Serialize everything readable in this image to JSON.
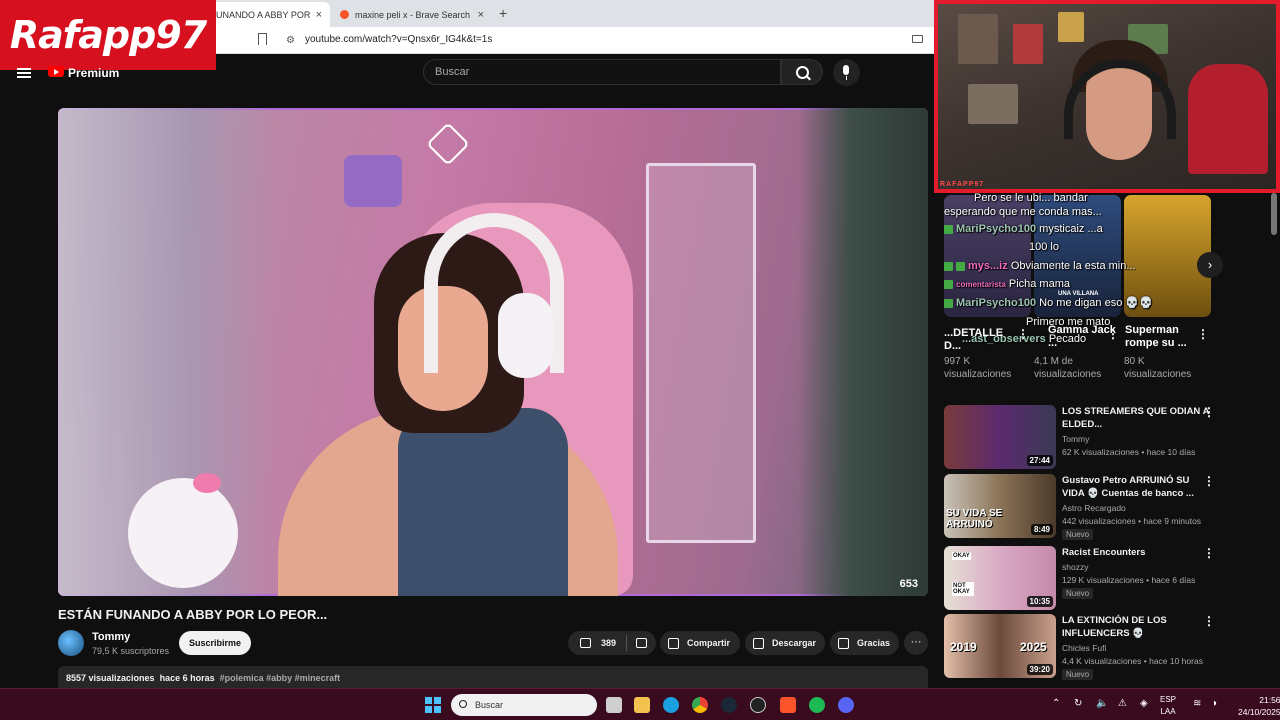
{
  "browser": {
    "tabs": [
      {
        "label": "ESTÁN FUNANDO A ABBY POR LO PEOR... - YouTube",
        "close": "×"
      },
      {
        "label": "maxine peli x - Brave Search",
        "close": "×"
      }
    ],
    "new_tab": "+",
    "url": "youtube.com/watch?v=Qnsx6r_IG4k&t=1s"
  },
  "overlay": {
    "logo_text": "Rafapp97",
    "webcam_label": "RAFAPP97"
  },
  "youtube": {
    "brand": "Premium",
    "search_placeholder": "Buscar",
    "video": {
      "title": "ESTÁN FUNANDO A ABBY POR LO PEOR...",
      "watermark": "653",
      "channel": "Tommy",
      "subscribers": "79,5 K suscriptores",
      "subscribe_label": "Suscribirme",
      "likes": "389",
      "share_label": "Compartir",
      "download_label": "Descargar",
      "thanks_label": "Gracias",
      "more": "···",
      "views": "8557 visualizaciones",
      "age": "hace 6 horas",
      "tags": "#polemica #abby #minecraft"
    },
    "chat": [
      {
        "user": "",
        "text": "Pero se le ubi... bandar"
      },
      {
        "user": "",
        "text": "esperando que me conda mas..."
      },
      {
        "user": "MariPsycho100",
        "text": "mysticaiz ...a"
      },
      {
        "user": "",
        "text": "100 lo"
      },
      {
        "user": "mys...iz",
        "text": "Obviamente la esta min..."
      },
      {
        "user": "comentarista",
        "text": "Picha mama"
      },
      {
        "user": "MariPsycho100",
        "text": "No me digan eso 💀💀"
      },
      {
        "user": "",
        "text": "Primero me mato"
      },
      {
        "user": "...ast_observers",
        "text": "Pecado"
      }
    ],
    "shorts": [
      {
        "title": "...DETALLE D...",
        "views": "997 K visualizaciones"
      },
      {
        "title": "Gamma Jack ...",
        "views": "4,1 M de visualizaciones",
        "label": "UNA VILLANA"
      },
      {
        "title": "Superman rompe su ...",
        "views": "80 K visualizaciones"
      }
    ],
    "next": "›",
    "kebab": "⋮",
    "recommendations": [
      {
        "title": "LOS STREAMERS QUE ODIAN A ELDED...",
        "channel": "Tommy",
        "views": "62 K visualizaciones • hace 10 días",
        "duration": "27:44",
        "badge": ""
      },
      {
        "title": "Gustavo Petro ARRUINÓ SU VIDA 💀 Cuentas de banco ...",
        "channel": "Astro Recargado",
        "views": "442 visualizaciones • hace 9 minutos",
        "duration": "8:49",
        "badge": "Nuevo",
        "thumb_text": "SU VIDA SE ARRUINÓ"
      },
      {
        "title": "Racist Encounters",
        "channel": "shozzy",
        "views": "129 K visualizaciones • hace 6 días",
        "duration": "10:35",
        "badge": "Nuevo",
        "thumb_text_1": "OKAY",
        "thumb_text_2": "NOT OKAY"
      },
      {
        "title": "LA EXTINCIÓN DE LOS INFLUENCERS 💀",
        "channel": "Chicles Fufi",
        "views": "4,4 K visualizaciones • hace 10 horas",
        "duration": "39:20",
        "badge": "Nuevo",
        "thumb_text_1": "2019",
        "thumb_text_2": "2025"
      }
    ]
  },
  "taskbar": {
    "search_placeholder": "Buscar",
    "lang": "ESP",
    "lang2": "LAA",
    "time": "21:56",
    "date": "24/10/2025",
    "colors": {
      "background": "#3a0a1e",
      "accent": "#4cc2ff"
    }
  }
}
